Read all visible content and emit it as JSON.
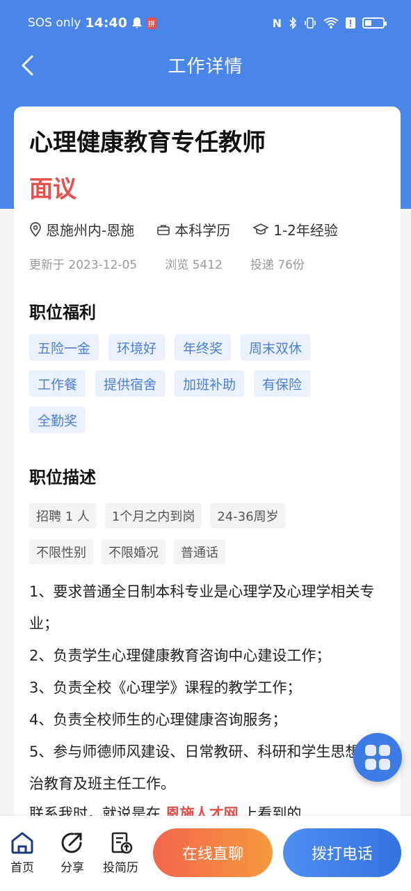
{
  "status_bar": {
    "carrier": "SOS only",
    "time": "14:40",
    "notification_badge": "拼"
  },
  "nav": {
    "title": "工作详情"
  },
  "job": {
    "title": "心理健康教育专任教师",
    "salary": "面议",
    "location": "恩施州内-恩施",
    "education": "本科学历",
    "experience": "1-2年经验",
    "updated": "更新于 2023-12-05",
    "views": "浏览 5412",
    "applications": "投递 76份"
  },
  "benefits": {
    "title": "职位福利",
    "tags": [
      "五险一金",
      "环境好",
      "年终奖",
      "周末双休",
      "工作餐",
      "提供宿舍",
      "加班补助",
      "有保险",
      "全勤奖"
    ]
  },
  "description": {
    "title": "职位描述",
    "requirements": [
      "招聘 1 人",
      "1个月之内到岗",
      "24-36周岁",
      "不限性别",
      "不限婚况",
      "普通话"
    ],
    "lines": [
      "1、要求普通全日制本科专业是心理学及心理学相关专业；",
      "2、负责学生心理健康教育咨询中心建设工作；",
      "3、负责全校《心理学》课程的教学工作；",
      "4、负责全校师生的心理健康咨询服务；",
      "5、参与师德师风建设、日常教研、科研和学生思想政治教育及班主任工作。"
    ],
    "contact_prefix": "联系我时，就说是在",
    "contact_site": "恩施人才网",
    "contact_suffix": "上看到的"
  },
  "bottom_bar": {
    "home": "首页",
    "share": "分享",
    "resume": "投简历",
    "chat_button": "在线直聊",
    "call_button": "拨打电话"
  },
  "colors": {
    "primary_blue": "#4a86ea",
    "salary_red": "#e2524a",
    "chat_orange": "#f2664c",
    "call_blue": "#3474e0"
  }
}
